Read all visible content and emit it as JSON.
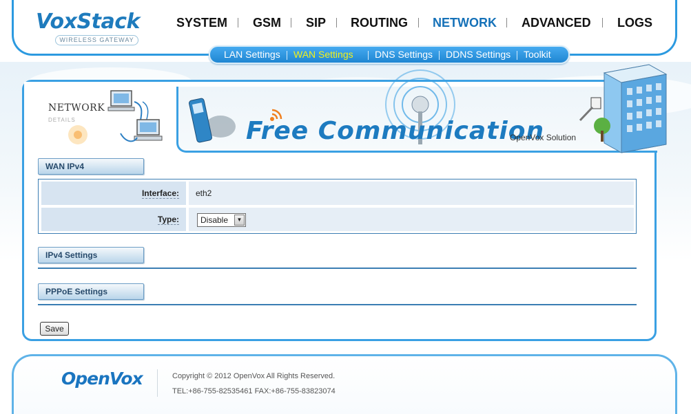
{
  "brand": {
    "logo_text": "VoxStack",
    "logo_sub": "WIRELESS GATEWAY"
  },
  "main_nav": [
    {
      "label": "SYSTEM",
      "active": false
    },
    {
      "label": "GSM",
      "active": false
    },
    {
      "label": "SIP",
      "active": false
    },
    {
      "label": "ROUTING",
      "active": false
    },
    {
      "label": "NETWORK",
      "active": true
    },
    {
      "label": "ADVANCED",
      "active": false
    },
    {
      "label": "LOGS",
      "active": false
    }
  ],
  "sub_nav": [
    {
      "label": "LAN Settings",
      "active": false
    },
    {
      "label": "WAN Settings",
      "active": true
    },
    {
      "label": "DNS Settings",
      "active": false
    },
    {
      "label": "DDNS Settings",
      "active": false
    },
    {
      "label": "Toolkit",
      "active": false
    }
  ],
  "banner": {
    "section_title": "NETWORK",
    "section_sub": "DETAILS",
    "slogan": "Free Communication",
    "tagline": "OpenVox Solution"
  },
  "wan_ipv4": {
    "title": "WAN IPv4",
    "interface_label": "Interface:",
    "interface_value": "eth2",
    "type_label": "Type:",
    "type_value": "Disable"
  },
  "ipv4_settings": {
    "title": "IPv4 Settings"
  },
  "pppoe_settings": {
    "title": "PPPoE Settings"
  },
  "actions": {
    "save_label": "Save"
  },
  "footer": {
    "logo_text": "OpenVox",
    "copyright": "Copyright © 2012 OpenVox All Rights Reserved.",
    "contact": "TEL:+86-755-82535461 FAX:+86-755-83823074"
  },
  "colors": {
    "accent": "#2c9ae0",
    "active_nav": "#1571b8",
    "active_sub_nav": "#f4f21a",
    "section_border": "#3a7db3"
  }
}
